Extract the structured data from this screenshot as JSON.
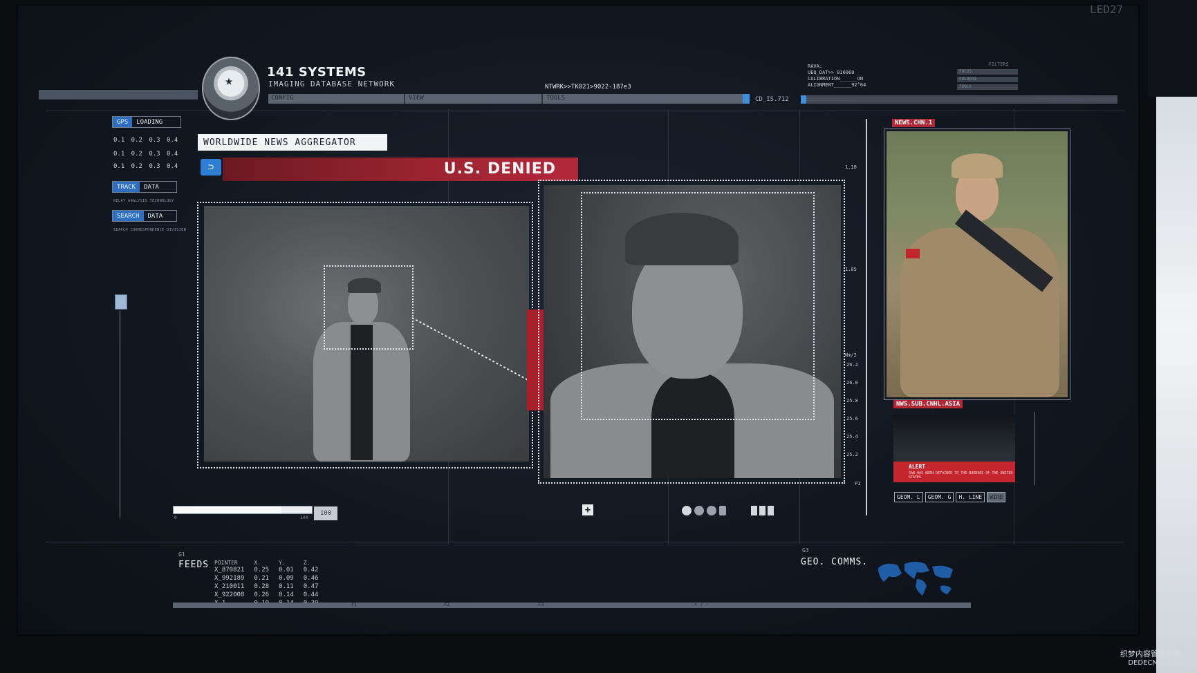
{
  "header": {
    "title": "141 SYSTEMS",
    "subtitle": "IMAGING DATABASE NETWORK",
    "menu": [
      "CONFIG",
      "VIEW",
      "TOOLS"
    ],
    "network_id": "NTWRK>>TK021>9022-187e3",
    "coord_label": "CD_IS.712",
    "calibration_lines": [
      "RAVA:",
      "UEQ_DAT>> 010060",
      "CALIBRATION______ON",
      "ALIGNMENT______92°64"
    ],
    "filter_label": "FILTERS",
    "filter_items": [
      "FOCUS",
      "FOLDERS",
      "TOOLS"
    ],
    "corner": "LED27"
  },
  "left_panel": {
    "gps": {
      "hl": "GPS",
      "rest": "LOADING"
    },
    "num_rows": [
      "0.1  0.2  0.3  0.4",
      "0.1  0.2  0.3  0.4",
      "0.1  0.2  0.3  0.4"
    ],
    "track": {
      "hl": "TRACK",
      "rest": "DATA"
    },
    "track_caption": "RELAY ANALYSIS TECHNOLOGY",
    "search": {
      "hl": "SEARCH",
      "rest": "DATA"
    },
    "search_caption": "SEARCH CORRESPONDENCE DIVISION"
  },
  "news": {
    "aggregator_label": "WORLDWIDE NEWS AGGREGATOR",
    "headline": "U.S. DENIED",
    "channel_1": "NEWS.CHN.1",
    "channel_2": "NWS.SUB.CNHL.ASIA",
    "alert_title": "ALERT",
    "alert_text": "RAN HAS BEEN DETAINED TO THE BORDERS OF THE UNITED STATES",
    "geo_buttons": [
      "GEOM. L",
      "GEOM. G",
      "H. LINE",
      "WIRE"
    ]
  },
  "scale": {
    "top": "1.18",
    "mid": "1.05",
    "unit": "Nm/2",
    "values": [
      "26.2",
      "26.0",
      "25.8",
      "25.6",
      "25.4",
      "25.2"
    ],
    "bottom": "P1"
  },
  "bottom": {
    "slider_left": "0",
    "slider_right": "100",
    "slider_badge": "100",
    "slider_value": 0.78,
    "feeds_group": "G1",
    "feeds_title": "FEEDS",
    "feeds_columns": [
      "POINTER",
      "X.",
      "Y.",
      "Z."
    ],
    "feeds_rows": [
      [
        "X_870821",
        "0.25",
        "0.01",
        "0.42"
      ],
      [
        "X_992189",
        "0.21",
        "0.09",
        "0.46"
      ],
      [
        "X_210011",
        "0.28",
        "0.11",
        "0.47"
      ],
      [
        "X_922008",
        "0.26",
        "0.14",
        "0.44"
      ],
      [
        "X_1",
        "0.19",
        "0.14",
        "0.39"
      ]
    ],
    "geo_group": "G3",
    "geo_title": "GEO. COMMS.",
    "bar_labels": [
      "F1",
      "F2",
      "F3",
      "+ / -"
    ]
  },
  "watermark": {
    "line1": "织梦内容管理系统",
    "line2": "DEDECMS.COM"
  },
  "colors": {
    "accent_blue": "#2f6fc2",
    "alert_red": "#b22834",
    "banner_red": "#9d2430"
  }
}
